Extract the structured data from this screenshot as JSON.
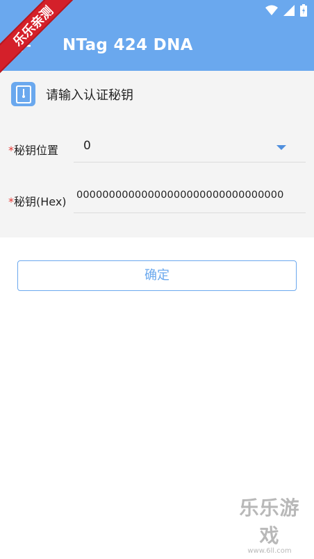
{
  "ribbon": "乐乐亲测",
  "appbar": {
    "title": "NTag 424 DNA"
  },
  "form": {
    "heading": "请输入认证秘钥",
    "key_position": {
      "required_mark": "*",
      "label": "秘钥位置",
      "value": "0"
    },
    "key_hex": {
      "required_mark": "*",
      "label": "秘钥(Hex)",
      "value": "00000000000000000000000000000000"
    }
  },
  "confirm_label": "确定",
  "watermark": {
    "main": "乐乐游戏",
    "sub": "www.6ll.com"
  },
  "colors": {
    "primary": "#6aa8ee",
    "required": "#e53935",
    "ribbon": "#d4202a"
  },
  "icons": [
    "back-arrow-icon",
    "wifi-icon",
    "signal-icon",
    "battery-icon",
    "sd-card-icon",
    "dropdown-caret-icon"
  ]
}
